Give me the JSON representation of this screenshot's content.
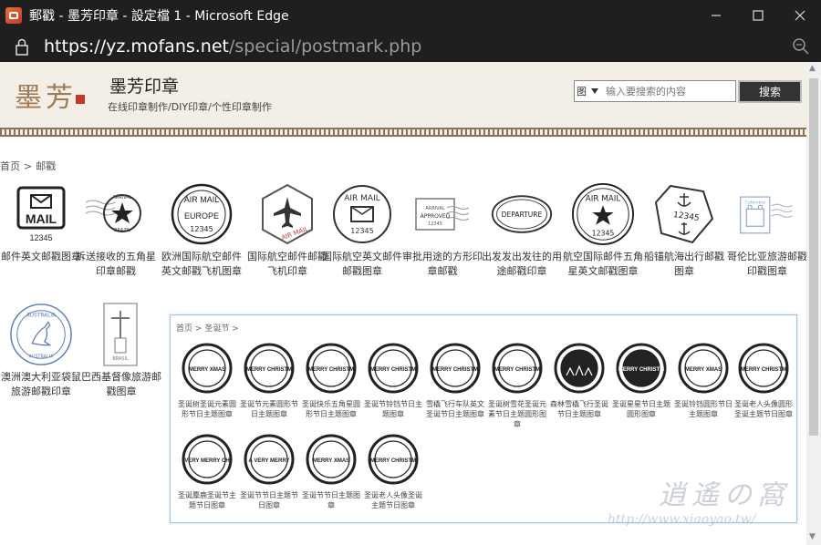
{
  "window": {
    "title": "郵戳 - 墨芳印章 - 設定檔 1 - Microsoft Edge"
  },
  "address": {
    "host": "https://yz.mofans.net",
    "path": "/special/postmark.php"
  },
  "header": {
    "logo_text": "墨芳",
    "site_title": "墨芳印章",
    "site_subtitle": "在线印章制作/DIY印章/个性印章制作",
    "search_select": "图",
    "search_placeholder": "输入要搜索的内容",
    "search_button": "搜索"
  },
  "breadcrumb": {
    "home": "首页",
    "sep": ">",
    "current": "邮戳"
  },
  "cards": [
    {
      "label": "邮件英文邮戳图章",
      "icon": "mail-stamp-icon"
    },
    {
      "label": "拆送接收的五角星印章邮戳",
      "icon": "arrival-star-stamp-icon"
    },
    {
      "label": "欧洲国际航空邮件英文邮戳飞机图章",
      "icon": "europe-airmail-stamp-icon"
    },
    {
      "label": "国际航空邮件邮戳飞机印章",
      "icon": "airplane-stamp-icon"
    },
    {
      "label": "国际航空英文邮件邮戳图章",
      "icon": "airmail-envelope-stamp-icon"
    },
    {
      "label": "审批用途的方形印章邮戳",
      "icon": "approved-stamp-icon"
    },
    {
      "label": "出发发出发往的用途邮戳印章",
      "icon": "departure-stamp-icon"
    },
    {
      "label": "航空国际邮件五角星英文邮戳图章",
      "icon": "airmail-star-stamp-icon"
    },
    {
      "label": "船锚航海出行邮戳图章",
      "icon": "anchor-stamp-icon"
    },
    {
      "label": "哥伦比亚旅游邮戳印戳图章",
      "icon": "colombia-stamp-icon"
    },
    {
      "label": "澳洲澳大利亚袋鼠旅游邮戳印章",
      "icon": "australia-kangaroo-stamp-icon"
    },
    {
      "label": "巴西基督像旅游邮戳图章",
      "icon": "brazil-stamp-icon"
    }
  ],
  "popup": {
    "breadcrumb_home": "首页",
    "breadcrumb_sep": ">",
    "breadcrumb_current": "圣诞节",
    "items": [
      {
        "label": "圣诞树圣诞元素圆形节日主题图章",
        "text": "MERRY XMAS"
      },
      {
        "label": "圣诞节元素圆形节日主题图章",
        "text": "MERRY CHRISTMAS"
      },
      {
        "label": "圣诞快乐五角星圆形节日主题图章",
        "text": "MERRY CHRISTMAS"
      },
      {
        "label": "圣诞节铃铛节日主题图章",
        "text": "MERRY CHRISTMAS"
      },
      {
        "label": "雪橇飞行车队英文圣诞节日主题图章",
        "text": "MERRY CHRISTMAS"
      },
      {
        "label": "圣诞树雪花圣诞元素节日主题圆形图章",
        "text": "MERRY CHRISTMAS"
      },
      {
        "label": "森林雪橇飞行圣诞节日主题图章",
        "text": ""
      },
      {
        "label": "圣诞星星节日主题圆形图章",
        "text": "MERRY CHRISTMAS TO YOU"
      },
      {
        "label": "圣诞铃铛圆形节日主题图章",
        "text": "MERRY XMAS"
      },
      {
        "label": "圣诞老人头像圆形圣诞主题节日图章",
        "text": "MERRY CHRISTMAS"
      },
      {
        "label": "圣诞麋鹿圣诞节主题节日图章",
        "text": "VERY MERRY CHRISTMAS TO YOU"
      },
      {
        "label": "圣诞节节日主题节日图章",
        "text": "A VERY MERRY CHRISTMAS TO YOU"
      },
      {
        "label": "圣诞节节日主题图章",
        "text": "MERRY XMAS"
      },
      {
        "label": "圣诞老人头像圣诞主题节日图章",
        "text": "MERRY CHRISTMAS TO YOU"
      }
    ]
  },
  "watermark": {
    "line1": "逍遙の窩",
    "line2": "http://www.xiaoyao.tw/"
  }
}
